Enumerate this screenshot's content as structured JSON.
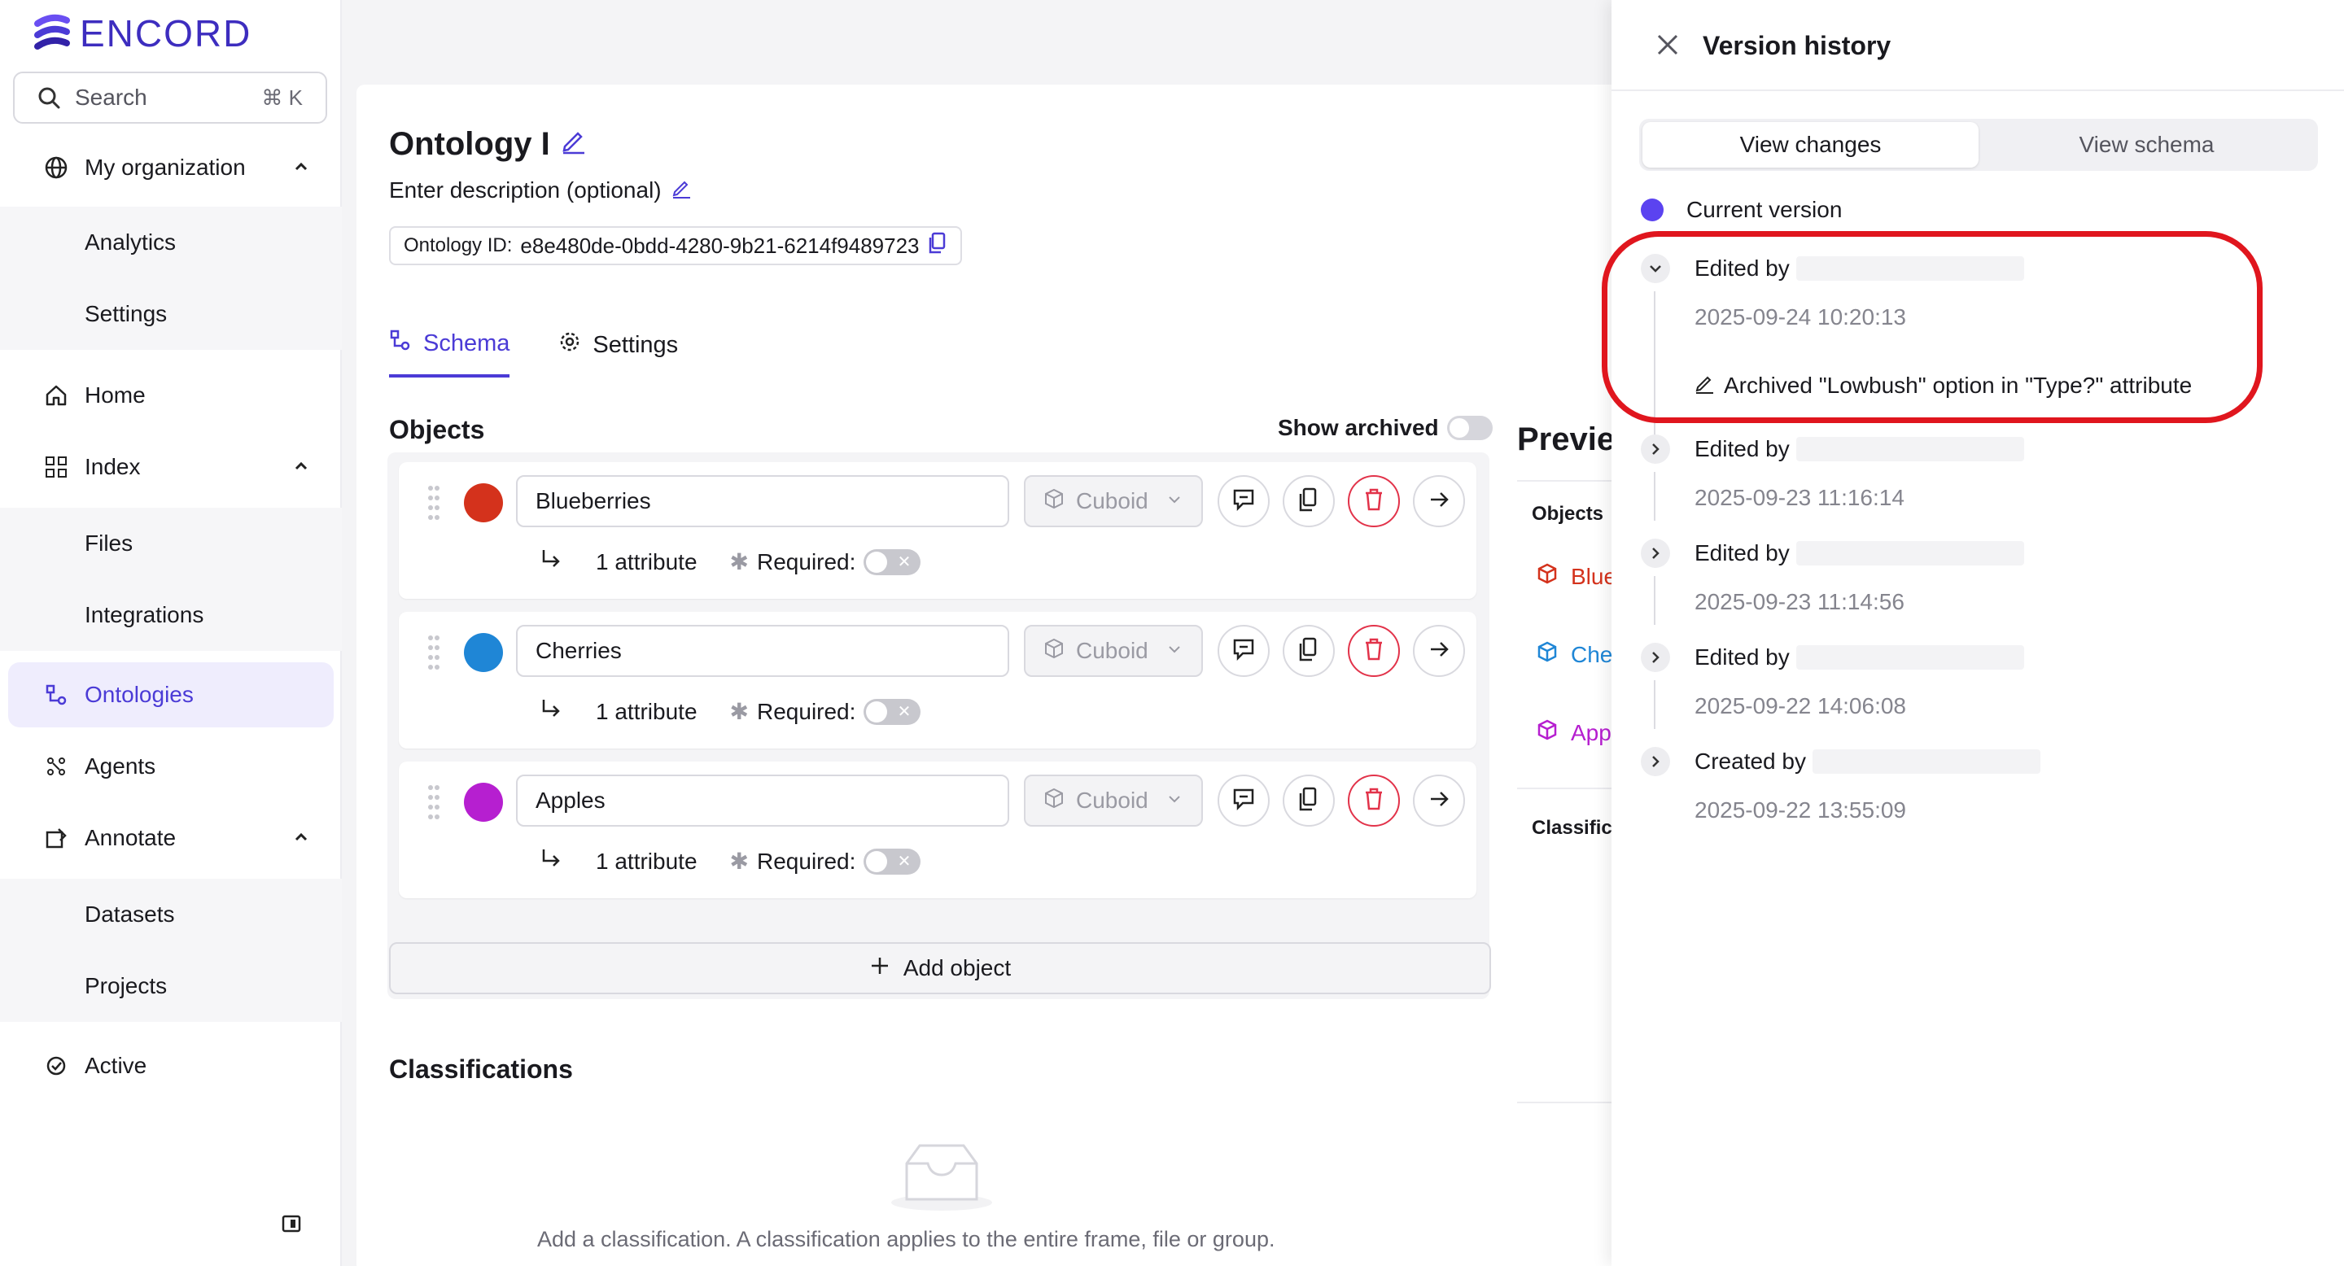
{
  "brand": {
    "name": "ENCORD",
    "color": "#4b3bd6"
  },
  "search": {
    "label": "Search",
    "shortcut": "⌘ K"
  },
  "sidebar": {
    "my_org": "My organization",
    "my_org_items": [
      "Analytics",
      "Settings"
    ],
    "home": "Home",
    "index": "Index",
    "index_items": [
      "Files",
      "Integrations"
    ],
    "ontologies": "Ontologies",
    "agents": "Agents",
    "annotate": "Annotate",
    "annotate_items": [
      "Datasets",
      "Projects"
    ],
    "active": "Active"
  },
  "ontology": {
    "title": "Ontology I",
    "description": "Enter description (optional)",
    "id_label": "Ontology ID:",
    "id_value": "e8e480de-0bdd-4280-9b21-6214f9489723"
  },
  "tabs": {
    "schema": "Schema",
    "settings": "Settings"
  },
  "objects_section": {
    "title": "Objects",
    "show_archived": "Show archived",
    "objects": [
      {
        "name": "Blueberries",
        "color": "#d4321c",
        "shape": "Cuboid",
        "attributes": "1 attribute",
        "required": "Required:"
      },
      {
        "name": "Cherries",
        "color": "#1f86d6",
        "shape": "Cuboid",
        "attributes": "1 attribute",
        "required": "Required:"
      },
      {
        "name": "Apples",
        "color": "#b61fd0",
        "shape": "Cuboid",
        "attributes": "1 attribute",
        "required": "Required:"
      }
    ],
    "add_object": "Add object"
  },
  "classifications": {
    "title": "Classifications",
    "empty_text": "Add a classification. A classification applies to the entire frame, file or group."
  },
  "preview": {
    "title": "Previe",
    "objects_label": "Objects",
    "items": [
      {
        "label": "Blue",
        "color": "#d4321c"
      },
      {
        "label": "Che",
        "color": "#1f86d6"
      },
      {
        "label": "App",
        "color": "#b61fd0"
      }
    ],
    "classifications_label": "Classific"
  },
  "version_history": {
    "title": "Version history",
    "tabs": {
      "changes": "View changes",
      "schema": "View schema"
    },
    "current": "Current version",
    "entries": [
      {
        "action": "Edited by",
        "date": "2025-09-24 10:20:13",
        "change": "Archived \"Lowbush\" option in \"Type?\" attribute"
      },
      {
        "action": "Edited by",
        "date": "2025-09-23 11:16:14"
      },
      {
        "action": "Edited by",
        "date": "2025-09-23 11:14:56"
      },
      {
        "action": "Edited by",
        "date": "2025-09-22 14:06:08"
      },
      {
        "action": "Created by",
        "date": "2025-09-22 13:55:09"
      }
    ],
    "highlight_color": "#e0161e"
  }
}
